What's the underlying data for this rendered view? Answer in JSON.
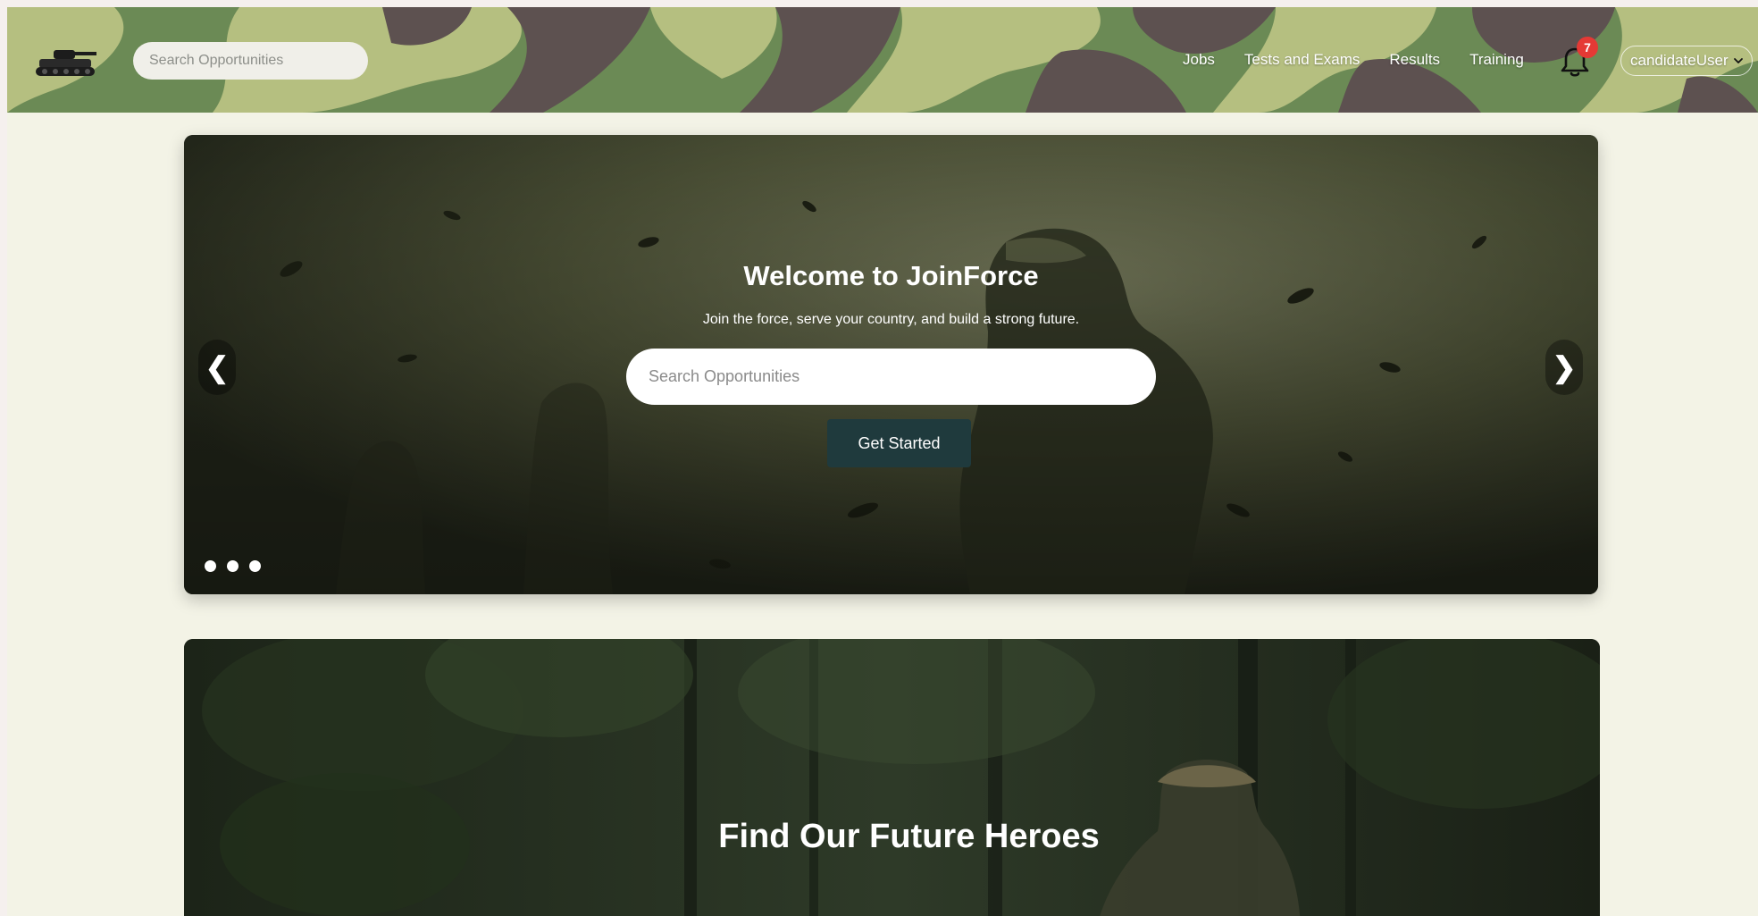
{
  "navbar": {
    "search_placeholder": "Search Opportunities",
    "links": [
      "Jobs",
      "Tests and Exams",
      "Results",
      "Training"
    ],
    "notification_count": "7",
    "user_name": "candidateUser",
    "logo_icon": "tank-icon",
    "colors": {
      "camo_light": "#b5bf80",
      "camo_mid": "#6b8a55",
      "camo_dark": "#5d5150"
    }
  },
  "hero": {
    "title": "Welcome to JoinForce",
    "subtitle": "Join the force, serve your country, and build a strong future.",
    "search_placeholder": "Search Opportunities",
    "cta_label": "Get Started",
    "prev_label": "❮",
    "next_label": "❯",
    "slide_count": 3
  },
  "banner": {
    "title": "Find Our Future Heroes"
  }
}
